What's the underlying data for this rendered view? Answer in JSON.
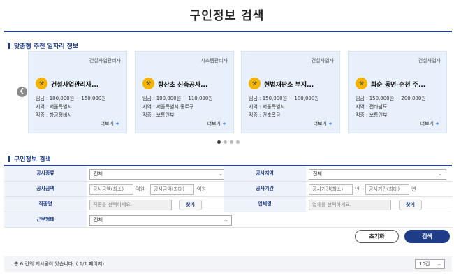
{
  "page": {
    "title": "구인정보 검색"
  },
  "recommend": {
    "section_title": "맞춤형 추천 일자리 정보",
    "cards": [
      {
        "category": "건설사업관리자",
        "company": "건설사업관리자...",
        "pay": "임금 : 100,000원 ~ 150,000원",
        "region": "지역 : 서울특별시",
        "job": "직종 : 항공정비사",
        "more": "더보기",
        "more_icon": "+"
      },
      {
        "category": "시스템관리자",
        "company": "향산초 신축공사...",
        "pay": "임금 : 100,000원 ~ 110,000원",
        "region": "지역 : 서울특별시 종로구",
        "job": "직종 : 보통인부",
        "more": "더보기",
        "more_icon": "+"
      },
      {
        "category": "건설사업자",
        "company": "헌법재판소 부지...",
        "pay": "임금 : 150,000원 ~ 180,000원",
        "region": "지역 : 서울특별시",
        "job": "직종 : 건축목공",
        "more": "더보기",
        "more_icon": "+"
      },
      {
        "category": "건설사업자",
        "company": "화순 동면-순천 주...",
        "pay": "임금 : 150,000원 ~ 200,000원",
        "region": "지역 : 전라남도",
        "job": "직종 : 보통인부",
        "more": "더보기",
        "more_icon": "+"
      }
    ],
    "prev_icon": "chevron-left-icon",
    "next_icon": "chevron-right-icon",
    "dots": 4,
    "active_dot": 0
  },
  "search": {
    "section_title": "구인정보 검색",
    "labels": {
      "work_type": "공사종류",
      "work_region": "공사지역",
      "work_amount": "공사금액",
      "work_period": "공사기간",
      "job_name": "직종명",
      "company_name": "업체명",
      "work_form": "근무형태"
    },
    "work_type_value": "전체",
    "work_region_value": "전체",
    "work_form_value": "전체",
    "amount_min_placeholder": "공사금액(최소)",
    "amount_max_placeholder": "공사금액(최대)",
    "amount_unit": "억원",
    "amount_sep": "~",
    "period_min_placeholder": "공사기간(최소)",
    "period_max_placeholder": "공사기간(최대)",
    "period_unit": "년",
    "period_sep": "~",
    "job_placeholder": "직종을 선택하세요.",
    "company_placeholder": "업체를 선택하세요.",
    "find_label": "찾기",
    "reset_label": "초기화",
    "search_label": "검색"
  },
  "results": {
    "summary": "총 6 건의 게시물이 있습니다. ( 1/1 페이지)",
    "page_size": "10건"
  },
  "colors": {
    "primary": "#1f3c88",
    "card_bg": "#e8f0fb",
    "logo": "#f4b400"
  }
}
